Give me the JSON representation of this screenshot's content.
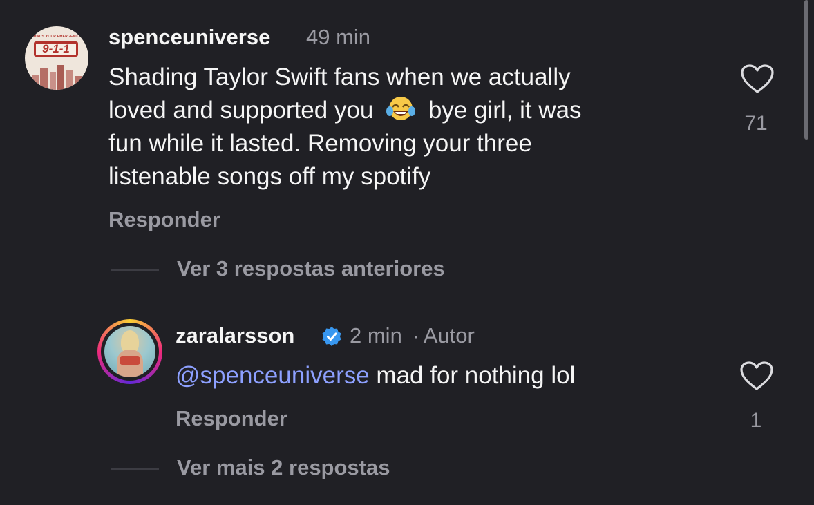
{
  "comments": [
    {
      "username": "spenceuniverse",
      "time": "49 min",
      "avatar": {
        "topline": "WHAT'S YOUR EMERGENCY?",
        "badge": "9-1-1"
      },
      "text_line1": "Shading Taylor Swift fans when we actually",
      "text_line2a": "loved and supported you",
      "emoji": "😂",
      "text_line2b": "bye girl, it was",
      "text_line3": "fun while it lasted. Removing your three",
      "text_line4": "listenable songs off my spotify",
      "reply_label": "Responder",
      "likes": "71",
      "view_replies": "Ver 3 respostas anteriores"
    },
    {
      "username": "zaralarsson",
      "verified": true,
      "time": "2 min",
      "separator": "·",
      "author_tag": "Autor",
      "mention": "@spenceuniverse",
      "text": " mad for nothing lol",
      "reply_label": "Responder",
      "likes": "1",
      "view_replies": "Ver mais 2 respostas"
    }
  ],
  "icons": {
    "like": "heart-outline-icon",
    "verified": "verified-badge-icon"
  },
  "colors": {
    "background": "#202025",
    "text": "#f5f5f5",
    "secondary": "#9a9aa2",
    "mention": "#8da0ff",
    "verified": "#3897f0"
  }
}
